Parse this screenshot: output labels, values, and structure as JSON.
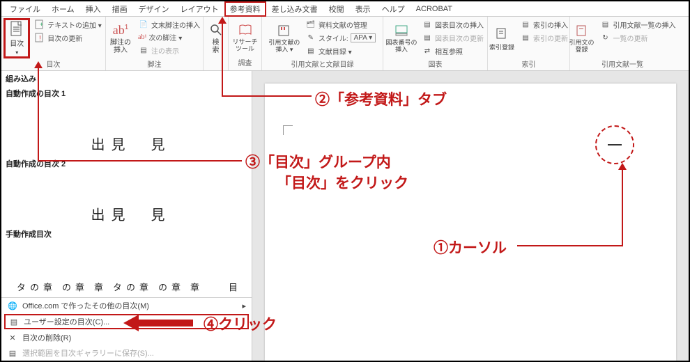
{
  "tabs": [
    "ファイル",
    "ホーム",
    "挿入",
    "描画",
    "デザイン",
    "レイアウト",
    "参考資料",
    "差し込み文書",
    "校閲",
    "表示",
    "ヘルプ",
    "ACROBAT"
  ],
  "ribbon": {
    "mokuji": {
      "big": "目次",
      "items": [
        "テキストの追加 ▾",
        "目次の更新"
      ],
      "group": "目次"
    },
    "kyakuchu": {
      "big": "脚注の\n挿入",
      "items": [
        "文末脚注の挿入",
        "次の脚注 ▾",
        "注の表示"
      ],
      "group": "脚注"
    },
    "kensaku": {
      "big": "検\n索"
    },
    "research": {
      "big": "リサーチ\nツール",
      "group": "調査"
    },
    "inyo": {
      "big": "引用文献の\n挿入 ▾",
      "items": [
        "資料文献の管理",
        "スタイル:",
        "APA ▾",
        "文献目録 ▾"
      ],
      "group": "引用文献と文献目録"
    },
    "zuban": {
      "big": "図表番号の\n挿入",
      "items": [
        "図表目次の挿入",
        "図表目次の更新",
        "相互参照"
      ],
      "group": "図表"
    },
    "sakuin": {
      "big": "索引登録",
      "items": [
        "索引の挿入",
        "索引の更新"
      ],
      "group": "索引"
    },
    "inyobun": {
      "big": "引用文の\n登録",
      "items": [
        "引用文献一覧の挿入",
        "一覧の更新"
      ],
      "group": "引用文献一覧"
    }
  },
  "gallery": {
    "builtin": "組み込み",
    "auto1": "自動作成の目次 1",
    "auto2": "自動作成の目次 2",
    "manual": "手動作成目次",
    "mi": "見",
    "dashi": "見\n出",
    "sho": "章",
    "shono": "章\nの",
    "shonota": "章\nの\nタ",
    "moku": "目",
    "office": "Office.com で作ったその他の目次(M)",
    "user": "ユーザー設定の目次(C)...",
    "delete": "目次の削除(R)",
    "save": "選択範囲を目次ギャラリーに保存(S)..."
  },
  "anno": {
    "a1": "①カーソル",
    "a2": "②「参考資料」タブ",
    "a3a": "③「目次」グループ内",
    "a3b": "「目次」をクリック",
    "a4": "④クリック"
  }
}
